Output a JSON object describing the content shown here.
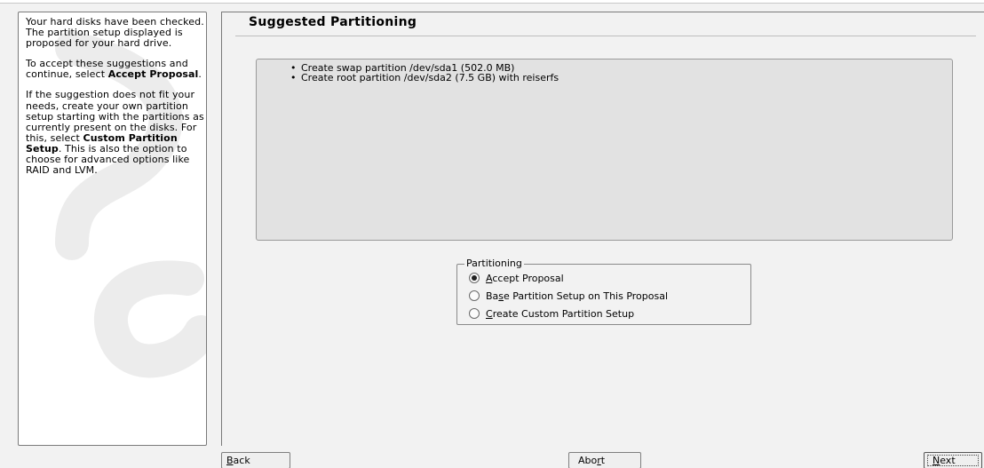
{
  "help": {
    "p1": "Your hard disks have been checked. The partition setup displayed is proposed for your hard drive.",
    "p2_pre": "To accept these suggestions and continue, select ",
    "p2_bold": "Accept Proposal",
    "p2_post": ".",
    "p3_pre": "If the suggestion does not fit your needs, create your own partition setup starting with the partitions as currently present on the disks. For this, select ",
    "p3_bold": "Custom Partition Setup",
    "p3_post": ". This is also the option to choose for advanced options like RAID and LVM."
  },
  "main": {
    "title": "Suggested Partitioning",
    "proposal_items": [
      "Create swap partition /dev/sda1 (502.0 MB)",
      "Create root partition /dev/sda2 (7.5 GB) with reiserfs"
    ]
  },
  "partitioning": {
    "legend": "Partitioning",
    "options": [
      {
        "pre": "",
        "hot": "A",
        "post": "ccept Proposal",
        "selected": true
      },
      {
        "pre": "Ba",
        "hot": "s",
        "post": "e Partition Setup on This Proposal",
        "selected": false
      },
      {
        "pre": "",
        "hot": "C",
        "post": "reate Custom Partition Setup",
        "selected": false
      }
    ]
  },
  "buttons": {
    "back": {
      "pre": "",
      "hot": "B",
      "post": "ack"
    },
    "abort": {
      "pre": "Abo",
      "hot": "r",
      "post": "t"
    },
    "next": {
      "pre": "",
      "hot": "N",
      "post": "ext"
    }
  }
}
